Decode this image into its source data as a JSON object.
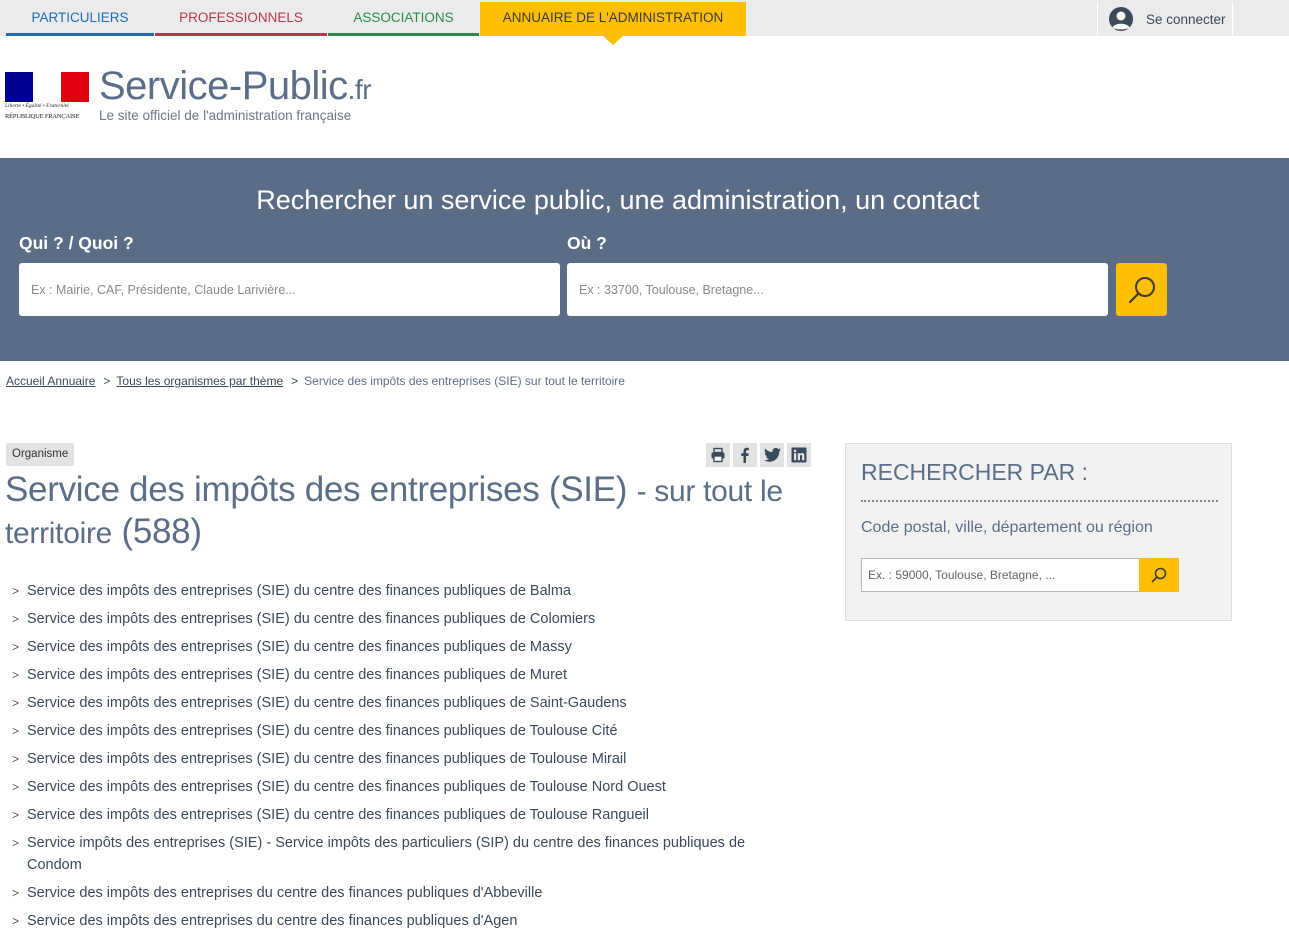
{
  "topnav": {
    "tabs": [
      {
        "label": "PARTICULIERS"
      },
      {
        "label": "PROFESSIONNELS"
      },
      {
        "label": "ASSOCIATIONS"
      },
      {
        "label": "ANNUAIRE DE L'ADMINISTRATION"
      }
    ],
    "connect_label": "Se connecter"
  },
  "header": {
    "logo_motto": "Liberté • Égalité • Fraternité",
    "logo_republic": "RÉPUBLIQUE FRANÇAISE",
    "site_name": "Service-Public",
    "site_tld": ".fr",
    "tagline": "Le site officiel de l'administration française"
  },
  "search": {
    "title": "Rechercher un service public, une administration, un contact",
    "qui_label": "Qui ? / Quoi ?",
    "qui_placeholder": "Ex : Mairie, CAF, Présidente, Claude Larivière...",
    "ou_label": "Où ?",
    "ou_placeholder": "Ex : 33700, Toulouse, Bretagne..."
  },
  "breadcrumb": {
    "items": [
      "Accueil Annuaire",
      "Tous les organismes par thème"
    ],
    "current": "Service des impôts des entreprises (SIE) sur tout le territoire",
    "separator": ">"
  },
  "main": {
    "badge": "Organisme",
    "title": "Service des impôts des entreprises (SIE)",
    "title_sub": "- sur tout le territoire",
    "title_count": "(588)",
    "results": [
      "Service des impôts des entreprises (SIE) du centre des finances publiques de Balma",
      "Service des impôts des entreprises (SIE) du centre des finances publiques de Colomiers",
      "Service des impôts des entreprises (SIE) du centre des finances publiques de Massy",
      "Service des impôts des entreprises (SIE) du centre des finances publiques de Muret",
      "Service des impôts des entreprises (SIE) du centre des finances publiques de Saint-Gaudens",
      "Service des impôts des entreprises (SIE) du centre des finances publiques de Toulouse Cité",
      "Service des impôts des entreprises (SIE) du centre des finances publiques de Toulouse Mirail",
      "Service des impôts des entreprises (SIE) du centre des finances publiques de Toulouse Nord Ouest",
      "Service des impôts des entreprises (SIE) du centre des finances publiques de Toulouse Rangueil",
      "Service impôts des entreprises (SIE) - Service impôts des particuliers (SIP) du centre des finances publiques de Condom",
      "Service des impôts des entreprises du centre des finances publiques d'Abbeville",
      "Service des impôts des entreprises du centre des finances publiques d'Agen"
    ]
  },
  "sidebar": {
    "title": "RECHERCHER PAR :",
    "label": "Code postal, ville, département ou région",
    "placeholder": "Ex. : 59000, Toulouse, Bretagne, ..."
  },
  "icons": {
    "user": "user-icon",
    "search": "search-icon",
    "print": "print-icon",
    "facebook": "facebook-icon",
    "twitter": "twitter-icon",
    "linkedin": "linkedin-icon"
  },
  "colors": {
    "accent_yellow": "#fcbf03",
    "band_blue": "#5b6d86",
    "particuliers": "#1f6bb0",
    "professionnels": "#b5394b",
    "associations": "#2d8a4a"
  }
}
